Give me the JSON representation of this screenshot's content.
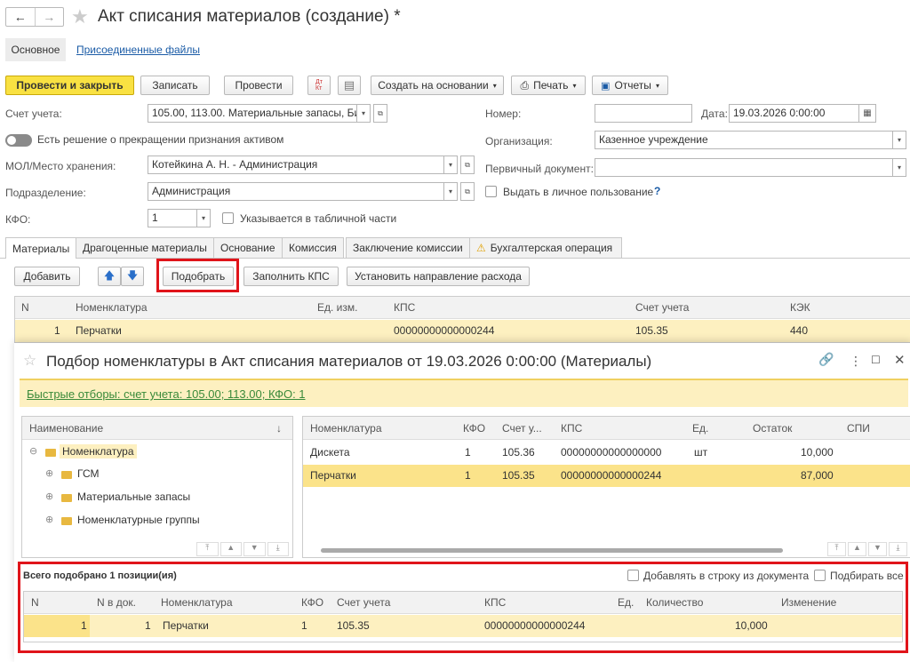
{
  "window": {
    "title": "Акт списания материалов (создание) *"
  },
  "sections": {
    "main": "Основное",
    "files": "Присоединенные файлы"
  },
  "toolbar": {
    "post_close": "Провести и закрыть",
    "save": "Записать",
    "post": "Провести",
    "dt_kt": "Дт Кт",
    "create_based": "Создать на основании",
    "print": "Печать",
    "reports": "Отчеты"
  },
  "form": {
    "account_label": "Счет учета:",
    "account_value": "105.00, 113.00. Материальные запасы, Би",
    "decision_label": "Есть решение о прекращении признания активом",
    "mol_label": "МОЛ/Место хранения:",
    "mol_value": "Котейкина А. Н. - Администрация",
    "dept_label": "Подразделение:",
    "dept_value": "Администрация",
    "kfo_label": "КФО:",
    "kfo_value": "1",
    "kfo_table_label": "Указывается в табличной части",
    "number_label": "Номер:",
    "number_value": "",
    "date_label": "Дата:",
    "date_value": "19.03.2026  0:00:00",
    "org_label": "Организация:",
    "org_value": "Казенное учреждение",
    "primary_doc_label": "Первичный документ:",
    "primary_doc_value": "",
    "personal_use_label": "Выдать в личное пользование",
    "help": "?"
  },
  "tabs": [
    "Материалы",
    "Драгоценные материалы",
    "Основание",
    "Комиссия",
    "Заключение комиссии",
    "Бухгалтерская операция"
  ],
  "table_toolbar": {
    "add": "Добавить",
    "select": "Подобрать",
    "fill_kps": "Заполнить КПС",
    "set_direction": "Установить направление расхода"
  },
  "main_table": {
    "headers": {
      "n": "N",
      "nom": "Номенклатура",
      "unit": "Ед. изм.",
      "kps": "КПС",
      "account": "Счет учета",
      "kek": "КЭК"
    },
    "rows": [
      {
        "n": "1",
        "nom": "Перчатки",
        "unit": "",
        "kps": "00000000000000244",
        "account": "105.35",
        "kek": "440"
      }
    ]
  },
  "dialog": {
    "title": "Подбор номенклатуры в Акт списания материалов от 19.03.2026 0:00:00 (Материалы)",
    "quick_filter": "Быстрые отборы: счет учета: 105.00; 113.00; КФО: 1",
    "tree": {
      "header": "Наименование",
      "sort": "↓",
      "items": [
        {
          "label": "Номенклатура",
          "expander": "⊖"
        },
        {
          "label": "ГСМ",
          "expander": "⊕"
        },
        {
          "label": "Материальные запасы",
          "expander": "⊕"
        },
        {
          "label": "Номенклатурные группы",
          "expander": "⊕"
        }
      ]
    },
    "list": {
      "headers": {
        "nom": "Номенклатура",
        "kfo": "КФО",
        "account": "Счет у...",
        "kps": "КПС",
        "unit": "Ед.",
        "rest": "Остаток",
        "spi": "СПИ"
      },
      "rows": [
        {
          "nom": "Дискета",
          "kfo": "1",
          "account": "105.36",
          "kps": "00000000000000000",
          "unit": "шт",
          "rest": "10,000"
        },
        {
          "nom": "Перчатки",
          "kfo": "1",
          "account": "105.35",
          "kps": "00000000000000244",
          "unit": "",
          "rest": "87,000"
        }
      ]
    },
    "selected": {
      "total": "Всего подобрано 1 позиции(ия)",
      "add_to_row": "Добавлять в строку из документа",
      "select_all": "Подбирать все",
      "headers": {
        "n": "N",
        "n_doc": "N в док.",
        "nom": "Номенклатура",
        "kfo": "КФО",
        "account": "Счет учета",
        "kps": "КПС",
        "unit": "Ед.",
        "qty": "Количество",
        "change": "Изменение"
      },
      "rows": [
        {
          "n": "1",
          "n_doc": "1",
          "nom": "Перчатки",
          "kfo": "1",
          "account": "105.35",
          "kps": "00000000000000244",
          "unit": "",
          "qty": "10,000",
          "change": ""
        }
      ]
    }
  },
  "colors": {
    "accent_yellow": "#f9e142",
    "row_highlight": "#fdf0c0",
    "red_frame": "#e0141a",
    "link": "#1a5ba6"
  }
}
